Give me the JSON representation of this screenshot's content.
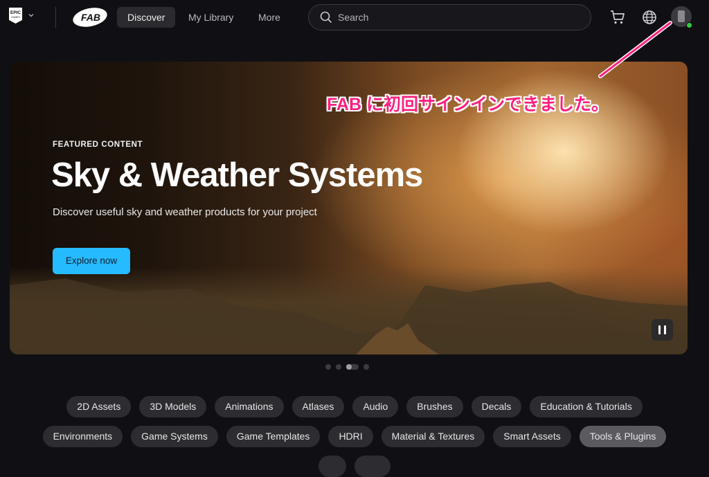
{
  "nav": {
    "epic_logo_text": "EPIC GAMES",
    "fab_logo_text": "FAB",
    "tabs": [
      {
        "label": "Discover",
        "active": true
      },
      {
        "label": "My Library",
        "active": false
      },
      {
        "label": "More",
        "active": false
      }
    ],
    "search": {
      "placeholder": "Search",
      "value": ""
    },
    "icons": [
      "cart-icon",
      "globe-icon",
      "avatar"
    ],
    "status": "online"
  },
  "hero": {
    "kicker": "FEATURED CONTENT",
    "title": "Sky & Weather Systems",
    "subtitle": "Discover useful sky and weather products for your project",
    "cta_label": "Explore now",
    "cta_color": "#26bbff",
    "carousel": {
      "count": 4,
      "active_index": 2
    }
  },
  "annotation": {
    "text": "FAB に初回サインインできました。",
    "color": "#ff1f7e"
  },
  "categories": {
    "row1": [
      "2D Assets",
      "3D Models",
      "Animations",
      "Atlases",
      "Audio",
      "Brushes",
      "Decals",
      "Education & Tutorials"
    ],
    "row2": [
      "Environments",
      "Game Systems",
      "Game Templates",
      "HDRI",
      "Material & Textures",
      "Smart Assets",
      "Tools & Plugins"
    ],
    "hovered": "Tools & Plugins"
  }
}
